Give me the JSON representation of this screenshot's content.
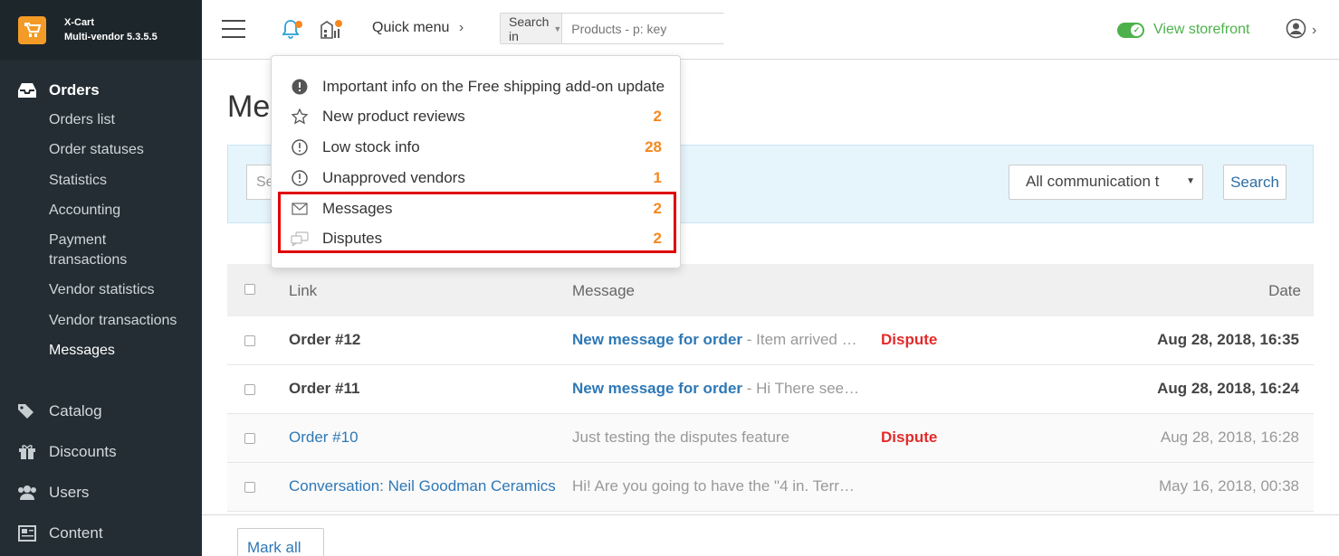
{
  "app": {
    "brand_name": "X-Cart",
    "brand_version": "Multi-vendor 5.3.5.5"
  },
  "sidebar": {
    "orders_label": "Orders",
    "orders_sub": [
      "Orders list",
      "Order statuses",
      "Statistics",
      "Accounting",
      "Payment transactions",
      "Vendor statistics",
      "Vendor transactions",
      "Messages"
    ],
    "catalog_label": "Catalog",
    "discounts_label": "Discounts",
    "users_label": "Users",
    "content_label": "Content"
  },
  "topbar": {
    "quick_menu": "Quick menu",
    "search_in": "Search in",
    "search_placeholder": "Products - p: key",
    "view_storefront": "View storefront"
  },
  "page": {
    "title": "Messages",
    "title_visible": "Me",
    "filter_input_placeholder": "Se",
    "filter_select_value": "All communication t",
    "search_button": "Search"
  },
  "table": {
    "headers": {
      "link": "Link",
      "message": "Message",
      "date": "Date"
    },
    "rows": [
      {
        "link": "Order #12",
        "msg_title": "New message for order",
        "msg_rest": " - Item arrived …",
        "tag": "Dispute",
        "date": "Aug 28, 2018, 16:35"
      },
      {
        "link": "Order #11",
        "msg_title": "New message for order",
        "msg_rest": " - Hi There see…",
        "tag": "",
        "date": "Aug 28, 2018, 16:24"
      },
      {
        "link": "Order #10",
        "message": "Just testing the disputes feature",
        "tag": "Dispute",
        "date": "Aug 28, 2018, 16:28"
      },
      {
        "link": "Conversation: Neil Goodman Ceramics",
        "message": "Hi! Are you going to have the \"4 in. Terr…",
        "tag": "",
        "date": "May 16, 2018, 00:38"
      }
    ],
    "mark_all": "Mark all"
  },
  "notifications": {
    "items": [
      {
        "label": "Important info on the Free shipping add-on update",
        "count": "",
        "icon": "exclamation-filled-icon"
      },
      {
        "label": "New product reviews",
        "count": "2",
        "icon": "star-icon"
      },
      {
        "label": "Low stock info",
        "count": "28",
        "icon": "exclamation-circle-icon"
      },
      {
        "label": "Unapproved vendors",
        "count": "1",
        "icon": "exclamation-circle-icon"
      },
      {
        "label": "Messages",
        "count": "2",
        "icon": "envelope-icon"
      },
      {
        "label": "Disputes",
        "count": "2",
        "icon": "chat-bubbles-icon"
      }
    ]
  },
  "colors": {
    "sidebar_bg": "#232d33",
    "accent_orange": "#f5881f",
    "link_blue": "#2e78b6",
    "storefront_green": "#4db14b",
    "dispute_red": "#e22b2b",
    "highlight_red": "#e00000"
  }
}
